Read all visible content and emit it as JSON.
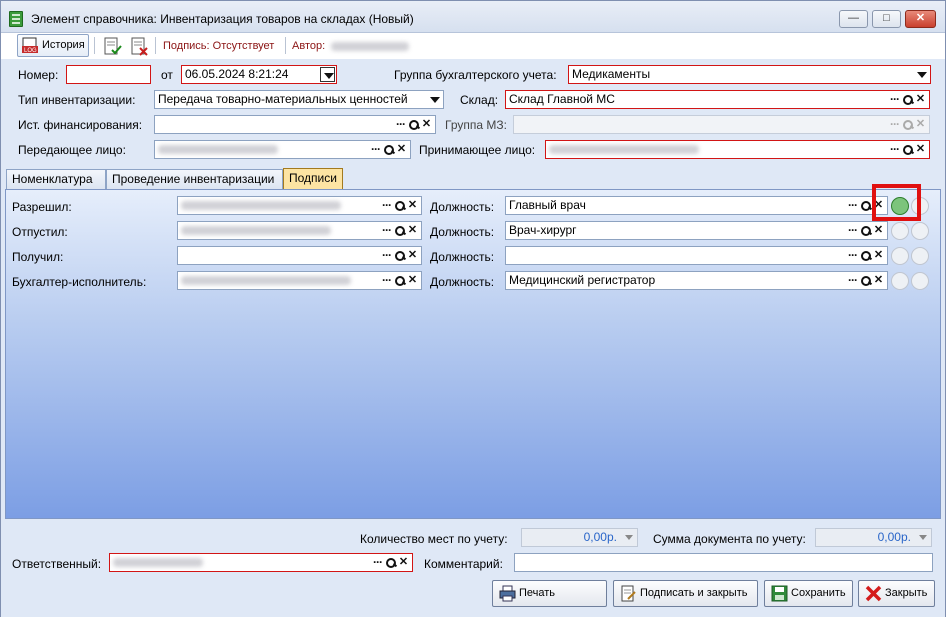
{
  "window": {
    "title": "Элемент справочника: Инвентаризация товаров на складах (Новый)",
    "minimize": "—",
    "maximize": "□",
    "close": "✕"
  },
  "toolbar": {
    "history_label": "История",
    "history_icon": "log-icon",
    "signature_label": "Подпись: Отсутствует",
    "author_label": "Автор:",
    "author_value": "[blurred]"
  },
  "form": {
    "number_label": "Номер:",
    "number_value": "",
    "from_label": "от",
    "date_value": "06.05.2024 8:21:24",
    "acc_group_label": "Группа бухгалтерского учета:",
    "acc_group_value": "Медикаменты",
    "inv_type_label": "Тип инвентаризации:",
    "inv_type_value": "Передача товарно-материальных ценностей",
    "warehouse_label": "Склад:",
    "warehouse_value": "Склад Главной МС",
    "funding_label": "Ист. финансирования:",
    "funding_value": "",
    "mz_group_label": "Группа МЗ:",
    "mz_group_value": "",
    "sender_label": "Передающее лицо:",
    "sender_value": "[blurred]",
    "receiver_label": "Принимающее лицо:",
    "receiver_value": "[blurred]"
  },
  "tabs": [
    {
      "label": "Номенклатура"
    },
    {
      "label": "Проведение инвентаризации"
    },
    {
      "label": "Подписи",
      "active": true
    }
  ],
  "signatures": [
    {
      "label": "Разрешил:",
      "person": "[blurred]",
      "position_label": "Должность:",
      "position": "Главный врач",
      "sign_enabled": true
    },
    {
      "label": "Отпустил:",
      "person": "[blurred]",
      "position_label": "Должность:",
      "position": "Врач-хирург",
      "sign_enabled": false
    },
    {
      "label": "Получил:",
      "person": "",
      "position_label": "Должность:",
      "position": "",
      "sign_enabled": false
    },
    {
      "label": "Бухгалтер-исполнитель:",
      "person": "[blurred]",
      "position_label": "Должность:",
      "position": "Медицинский регистратор",
      "sign_enabled": false
    }
  ],
  "footer": {
    "places_label": "Количество мест по учету:",
    "places_value": "0,00р.",
    "sum_label": "Сумма документа по учету:",
    "sum_value": "0,00р.",
    "responsible_label": "Ответственный:",
    "responsible_value": "[blurred]",
    "comment_label": "Комментарий:",
    "comment_value": ""
  },
  "buttons": {
    "print": "Печать",
    "sign_close": "Подписать и закрыть",
    "save": "Сохранить",
    "close": "Закрыть"
  },
  "icons": {
    "dots": "…",
    "search": "search-icon",
    "clear": "✕"
  },
  "colors": {
    "required_border": "#d21515",
    "active_tab": "#fde4a3",
    "highlight": "#e01010",
    "panel_bottom": "#7c9ee4"
  }
}
